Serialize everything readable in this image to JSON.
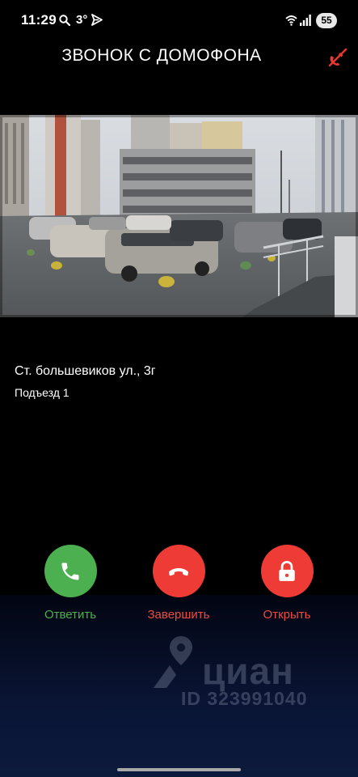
{
  "status_bar": {
    "time": "11:29",
    "temperature": "3°",
    "battery": "55",
    "icons": [
      "search-icon",
      "send-icon",
      "wifi-icon",
      "signal-icon"
    ]
  },
  "header": {
    "title": "ЗВОНОК С ДОМОФОНА",
    "mute_icon": "phone-off-icon"
  },
  "location": {
    "address": "Ст. большевиков ул., 3г",
    "entrance": "Подъезд 1"
  },
  "actions": {
    "answer_label": "Ответить",
    "hangup_label": "Завершить",
    "open_label": "Открыть",
    "answer_color": "#4caf50",
    "hangup_color": "#ef3b36",
    "open_color": "#ef3b36"
  },
  "watermark": {
    "brand": "циан",
    "id": "ID 323991040"
  }
}
